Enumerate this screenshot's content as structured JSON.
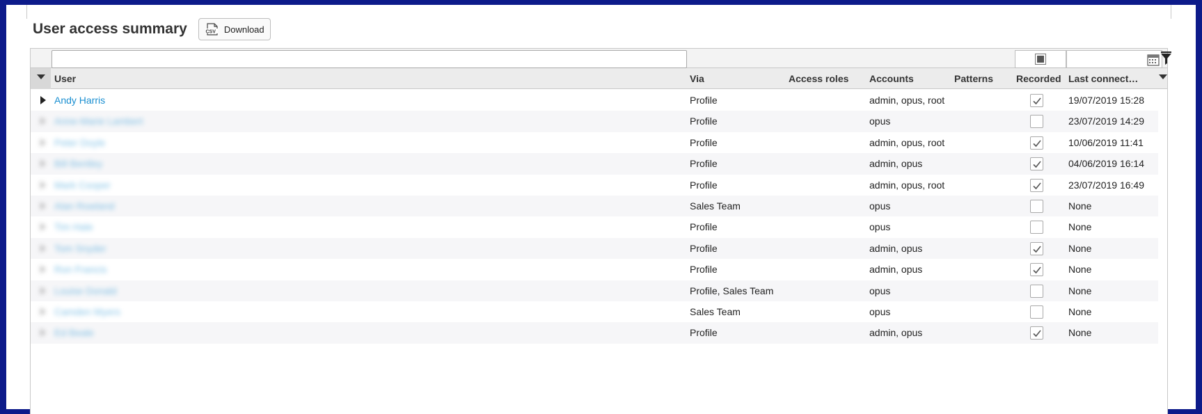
{
  "page": {
    "title": "User access summary",
    "download_label": "Download",
    "csv_icon": "csv-file-icon"
  },
  "filters": {
    "user_value": "",
    "recorded_state": "indeterminate",
    "date_value": "",
    "calendar_icon": "calendar-icon",
    "filter_icon": "funnel-icon"
  },
  "columns": {
    "user": "User",
    "via": "Via",
    "access_roles": "Access roles",
    "accounts": "Accounts",
    "patterns": "Patterns",
    "recorded": "Recorded",
    "last_connection": "Last connect…"
  },
  "rows": [
    {
      "user": "Andy Harris",
      "via": "Profile",
      "access_roles": "",
      "accounts": "admin, opus, root",
      "patterns": "",
      "recorded": true,
      "last_connection": "19/07/2019 15:28",
      "blurred": false
    },
    {
      "user": "Anne-Marie Lambert",
      "via": "Profile",
      "access_roles": "",
      "accounts": "opus",
      "patterns": "",
      "recorded": false,
      "last_connection": "23/07/2019 14:29",
      "blurred": true
    },
    {
      "user": "Peter Doyle",
      "via": "Profile",
      "access_roles": "",
      "accounts": "admin, opus, root",
      "patterns": "",
      "recorded": true,
      "last_connection": "10/06/2019 11:41",
      "blurred": true
    },
    {
      "user": "Bill Bentley",
      "via": "Profile",
      "access_roles": "",
      "accounts": "admin, opus",
      "patterns": "",
      "recorded": true,
      "last_connection": "04/06/2019 16:14",
      "blurred": true
    },
    {
      "user": "Mark Cooper",
      "via": "Profile",
      "access_roles": "",
      "accounts": "admin, opus, root",
      "patterns": "",
      "recorded": true,
      "last_connection": "23/07/2019 16:49",
      "blurred": true
    },
    {
      "user": "Alan Rowland",
      "via": "Sales Team",
      "access_roles": "",
      "accounts": "opus",
      "patterns": "",
      "recorded": false,
      "last_connection": "None",
      "blurred": true
    },
    {
      "user": "Tim Hale",
      "via": "Profile",
      "access_roles": "",
      "accounts": "opus",
      "patterns": "",
      "recorded": false,
      "last_connection": "None",
      "blurred": true
    },
    {
      "user": "Tom Snyder",
      "via": "Profile",
      "access_roles": "",
      "accounts": "admin, opus",
      "patterns": "",
      "recorded": true,
      "last_connection": "None",
      "blurred": true
    },
    {
      "user": "Ron Francis",
      "via": "Profile",
      "access_roles": "",
      "accounts": "admin, opus",
      "patterns": "",
      "recorded": true,
      "last_connection": "None",
      "blurred": true
    },
    {
      "user": "Louise Donald",
      "via": "Profile, Sales Team",
      "access_roles": "",
      "accounts": "opus",
      "patterns": "",
      "recorded": false,
      "last_connection": "None",
      "blurred": true
    },
    {
      "user": "Camden Myers",
      "via": "Sales Team",
      "access_roles": "",
      "accounts": "opus",
      "patterns": "",
      "recorded": false,
      "last_connection": "None",
      "blurred": true
    },
    {
      "user": "Ed Beale",
      "via": "Profile",
      "access_roles": "",
      "accounts": "admin, opus",
      "patterns": "",
      "recorded": true,
      "last_connection": "None",
      "blurred": true
    }
  ],
  "colors": {
    "frame": "#0d1b8a",
    "link": "#1a8fd1",
    "header_bg": "#ececec",
    "alt_row": "#f6f6f8"
  }
}
